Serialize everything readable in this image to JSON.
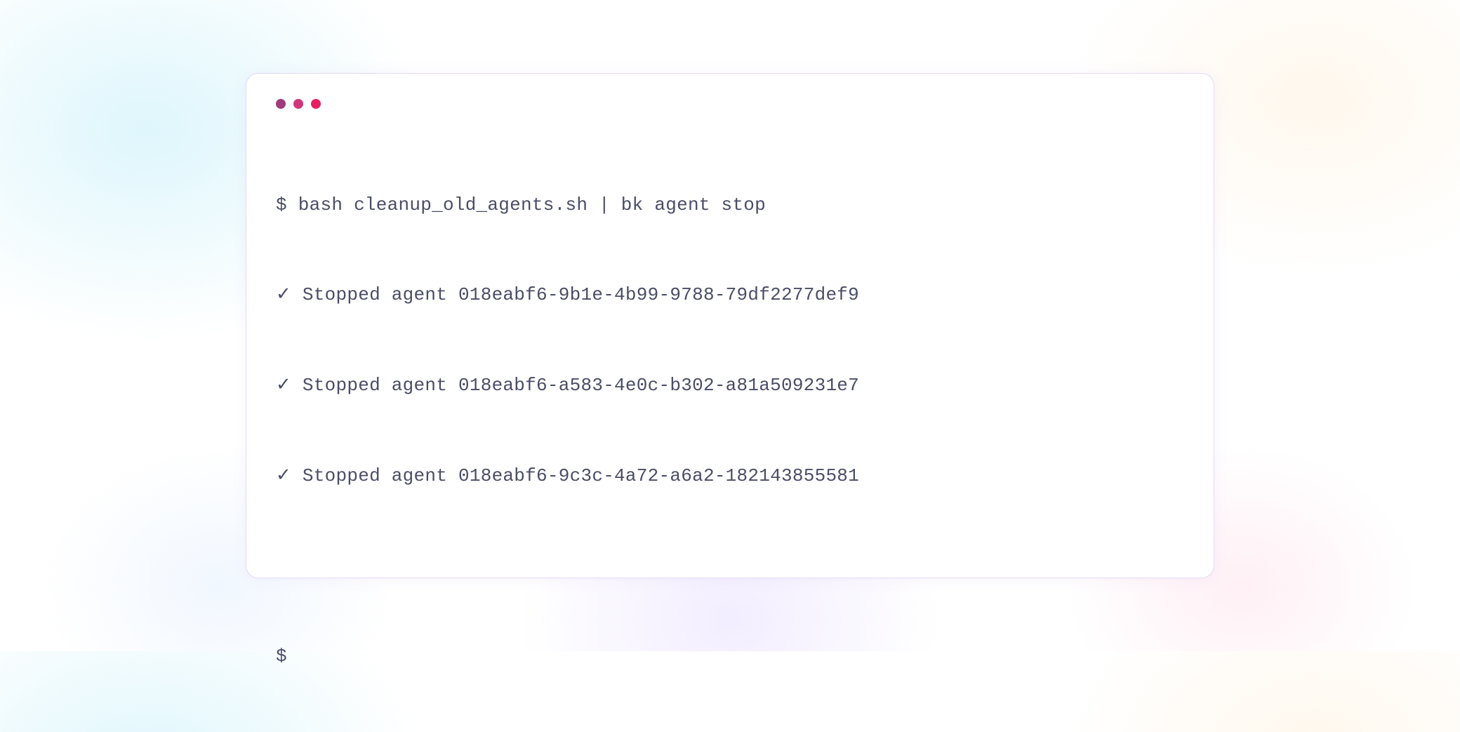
{
  "terminal": {
    "prompt_symbol": "$",
    "command": "bash cleanup_old_agents.sh | bk agent stop",
    "output_lines": [
      "✓ Stopped agent 018eabf6-9b1e-4b99-9788-79df2277def9",
      "✓ Stopped agent 018eabf6-a583-4e0c-b302-a81a509231e7",
      "✓ Stopped agent 018eabf6-9c3c-4a72-a6a2-182143855581"
    ],
    "final_prompt": "$"
  },
  "window_controls": {
    "dot1_color": "#a03b7c",
    "dot2_color": "#d1367a",
    "dot3_color": "#e81e63"
  }
}
